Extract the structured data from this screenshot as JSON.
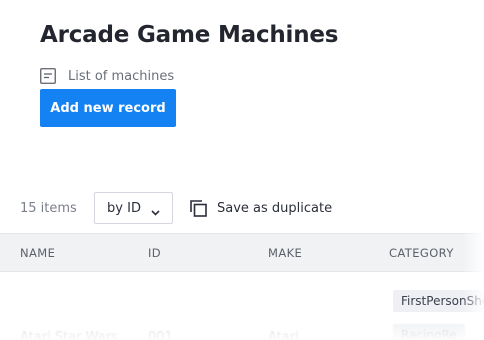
{
  "header": {
    "title": "Arcade Game Machines",
    "subtitle": "List of machines",
    "subtitle_icon": "list-icon"
  },
  "actions": {
    "add_label": "Add new record",
    "accent_color": "#1482f2"
  },
  "toolbar": {
    "items_count": "15 items",
    "sort_select": {
      "value": "by ID",
      "icon": "chevron-down-icon"
    },
    "duplicate_label": "Save as duplicate",
    "duplicate_icon": "copy-icon"
  },
  "table": {
    "columns": [
      "NAME",
      "ID",
      "MAKE",
      "CATEGORY"
    ],
    "rows": [
      {
        "name": "Atari Star Wars",
        "id": "001",
        "make": "Atari",
        "categories": [
          "FirstPersonShooter",
          "RacingRe"
        ]
      }
    ]
  }
}
